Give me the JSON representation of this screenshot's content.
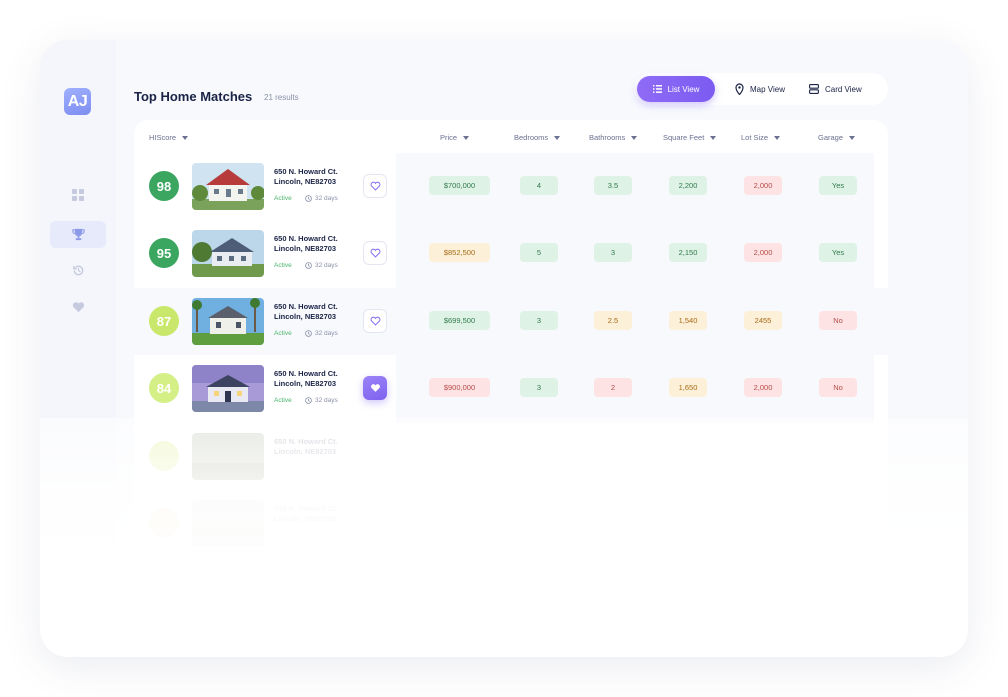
{
  "sidebar": {
    "logo": "AJ",
    "nav_icons": [
      "grid-icon",
      "trophy-icon",
      "history-icon",
      "heart-icon"
    ],
    "active_index": 1
  },
  "header": {
    "title": "Top Home Matches",
    "results": "21 results"
  },
  "views": {
    "list": "List View",
    "map": "Map View",
    "card": "Card View",
    "active": "List View"
  },
  "table": {
    "columns": {
      "score": "HIScore",
      "price": "Price",
      "bedrooms": "Bedrooms",
      "bathrooms": "Bathrooms",
      "sqft": "Square Feet",
      "lot": "Lot Size",
      "garage": "Garage"
    },
    "rows": [
      {
        "score": "98",
        "address1": "650 N. Howard Ct.",
        "address2": "Lincoln, NE82703",
        "status": "Active",
        "days": "32 days",
        "favorite": false,
        "price": "$700,000",
        "bedrooms": "4",
        "bathrooms": "3.5",
        "sqft": "2,200",
        "lot": "2,000",
        "garage": "Yes"
      },
      {
        "score": "95",
        "address1": "650 N. Howard Ct.",
        "address2": "Lincoln, NE82703",
        "status": "Active",
        "days": "32 days",
        "favorite": false,
        "price": "$852,500",
        "bedrooms": "5",
        "bathrooms": "3",
        "sqft": "2,150",
        "lot": "2,000",
        "garage": "Yes"
      },
      {
        "score": "87",
        "address1": "650 N. Howard Ct.",
        "address2": "Lincoln, NE82703",
        "status": "Active",
        "days": "32 days",
        "favorite": false,
        "price": "$699,500",
        "bedrooms": "3",
        "bathrooms": "2.5",
        "sqft": "1,540",
        "lot": "2455",
        "garage": "No"
      },
      {
        "score": "84",
        "address1": "650 N. Howard Ct.",
        "address2": "Lincoln, NE82703",
        "status": "Active",
        "days": "32 days",
        "favorite": true,
        "price": "$900,000",
        "bedrooms": "3",
        "bathrooms": "2",
        "sqft": "1,650",
        "lot": "2,000",
        "garage": "No"
      },
      {
        "address1": "650 N. Howard Ct.",
        "address2": "Lincoln, NE82703"
      },
      {
        "address1": "650 N. Howard Ct.",
        "address2": "Lincoln, NE82703"
      }
    ]
  },
  "colors": {
    "accent": "#7b5bf1",
    "score_green": "#3aa660",
    "score_lime": "#c9e86b",
    "pill_green": "#dff2e6",
    "pill_orange": "#fdf0d9",
    "pill_red": "#fde3e3"
  }
}
